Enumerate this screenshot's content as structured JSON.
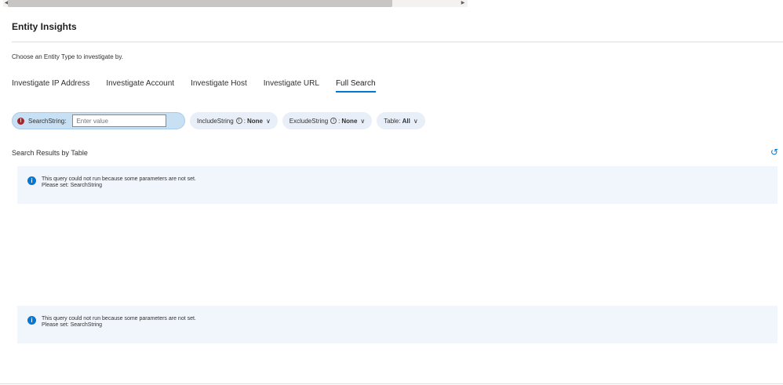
{
  "title": "Entity Insights",
  "hint": "Choose an Entity Type to investigate by.",
  "tabs": [
    {
      "label": "Investigate IP Address"
    },
    {
      "label": "Investigate Account"
    },
    {
      "label": "Investigate Host"
    },
    {
      "label": "Investigate URL"
    },
    {
      "label": "Full Search",
      "active": true
    }
  ],
  "params": {
    "search": {
      "label": "SearchString:",
      "placeholder": "Enter value",
      "error_icon": "!"
    },
    "include": {
      "label": "IncludeString",
      "info_icon": "i",
      "sep": ":",
      "value": "None"
    },
    "exclude": {
      "label": "ExcludeString",
      "info_icon": "i",
      "sep": ":",
      "value": "None"
    },
    "table": {
      "label": "Table:",
      "value": "All"
    },
    "chevron": "∨"
  },
  "section_title": "Search Results by Table",
  "refresh_icon": "↺",
  "messages": [
    {
      "icon": "i",
      "line1": "This query could not run because some parameters are not set.",
      "line2": "Please set: SearchString"
    },
    {
      "icon": "i",
      "line1": "This query could not run because some parameters are not set.",
      "line2": "Please set: SearchString"
    }
  ],
  "scroll": {
    "left_arrow": "◀",
    "right_arrow": "▶"
  }
}
